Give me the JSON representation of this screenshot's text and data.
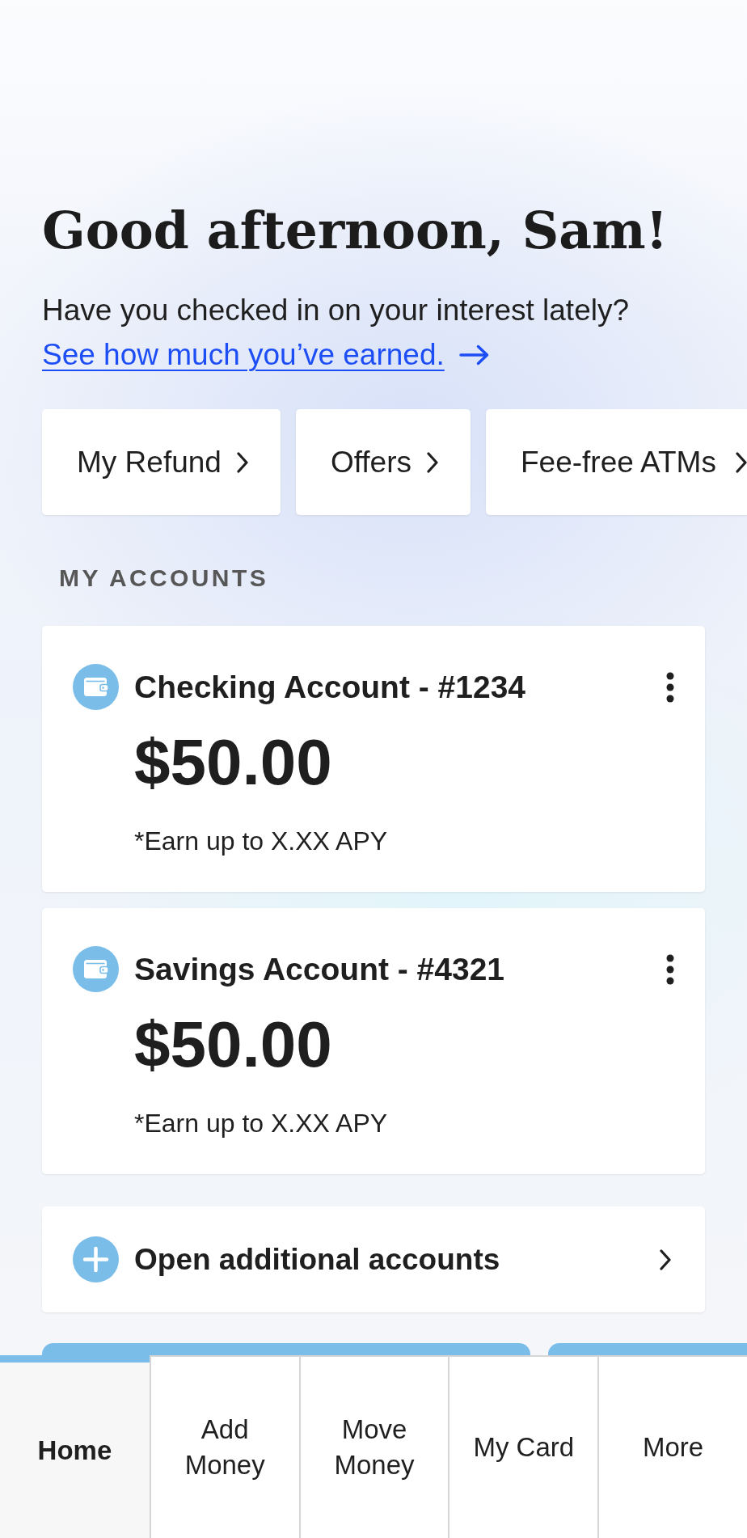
{
  "greeting": {
    "title": "Good afternoon, Sam!",
    "message": "Have you checked in on your interest lately?",
    "link": "See how much you’ve earned."
  },
  "quick_links": [
    {
      "label": "My Refund"
    },
    {
      "label": "Offers"
    },
    {
      "label": "Fee-free ATMs"
    }
  ],
  "accounts": {
    "heading": "MY ACCOUNTS",
    "items": [
      {
        "name": "Checking Account - #1234",
        "balance": "$50.00",
        "note": "*Earn up to X.XX APY"
      },
      {
        "name": "Savings Account - #4321",
        "balance": "$50.00",
        "note": "*Earn up to X.XX APY"
      }
    ]
  },
  "open_accounts": {
    "label": "Open additional accounts"
  },
  "bottom_nav": [
    {
      "label": "Home",
      "selected": true
    },
    {
      "label": "Add Money",
      "selected": false
    },
    {
      "label": "Move Money",
      "selected": false
    },
    {
      "label": "My Card",
      "selected": false
    },
    {
      "label": "More",
      "selected": false
    }
  ]
}
